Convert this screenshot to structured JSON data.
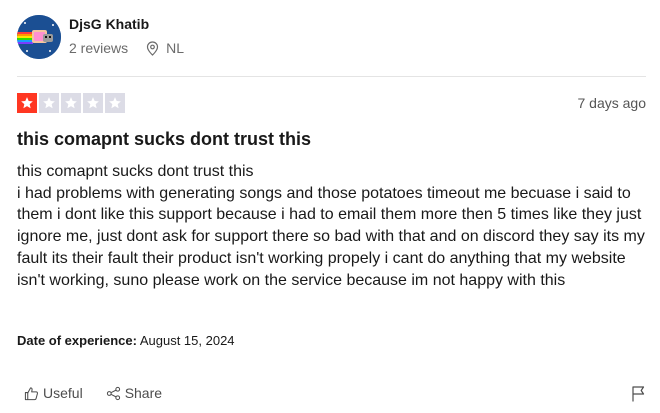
{
  "reviewer": {
    "name": "DjsG Khatib",
    "reviews_count": "2 reviews",
    "country": "NL",
    "avatar_icon": "nyan-cat-avatar"
  },
  "review": {
    "rating": 1,
    "max_rating": 5,
    "rating_color": "#ff3722",
    "empty_star_color": "#dcdce6",
    "posted": "7 days ago",
    "title": "this comapnt sucks dont trust this",
    "body_lines": [
      "this comapnt sucks dont trust this",
      "i had problems with generating songs and those potatoes timeout me becuase i said to them i dont like this support because i had to email them more then 5 times like they just ignore me, just dont ask for support there so bad with that and on discord they say its my fault its their fault their product isn't working propely i cant do anything that my website isn't working, suno please work on the service because im not happy with this"
    ],
    "experience_label": "Date of experience:",
    "experience_date": "August 15, 2024"
  },
  "actions": {
    "useful_label": "Useful",
    "share_label": "Share",
    "useful_icon": "thumbs-up-icon",
    "share_icon": "share-icon",
    "flag_icon": "flag-icon"
  }
}
